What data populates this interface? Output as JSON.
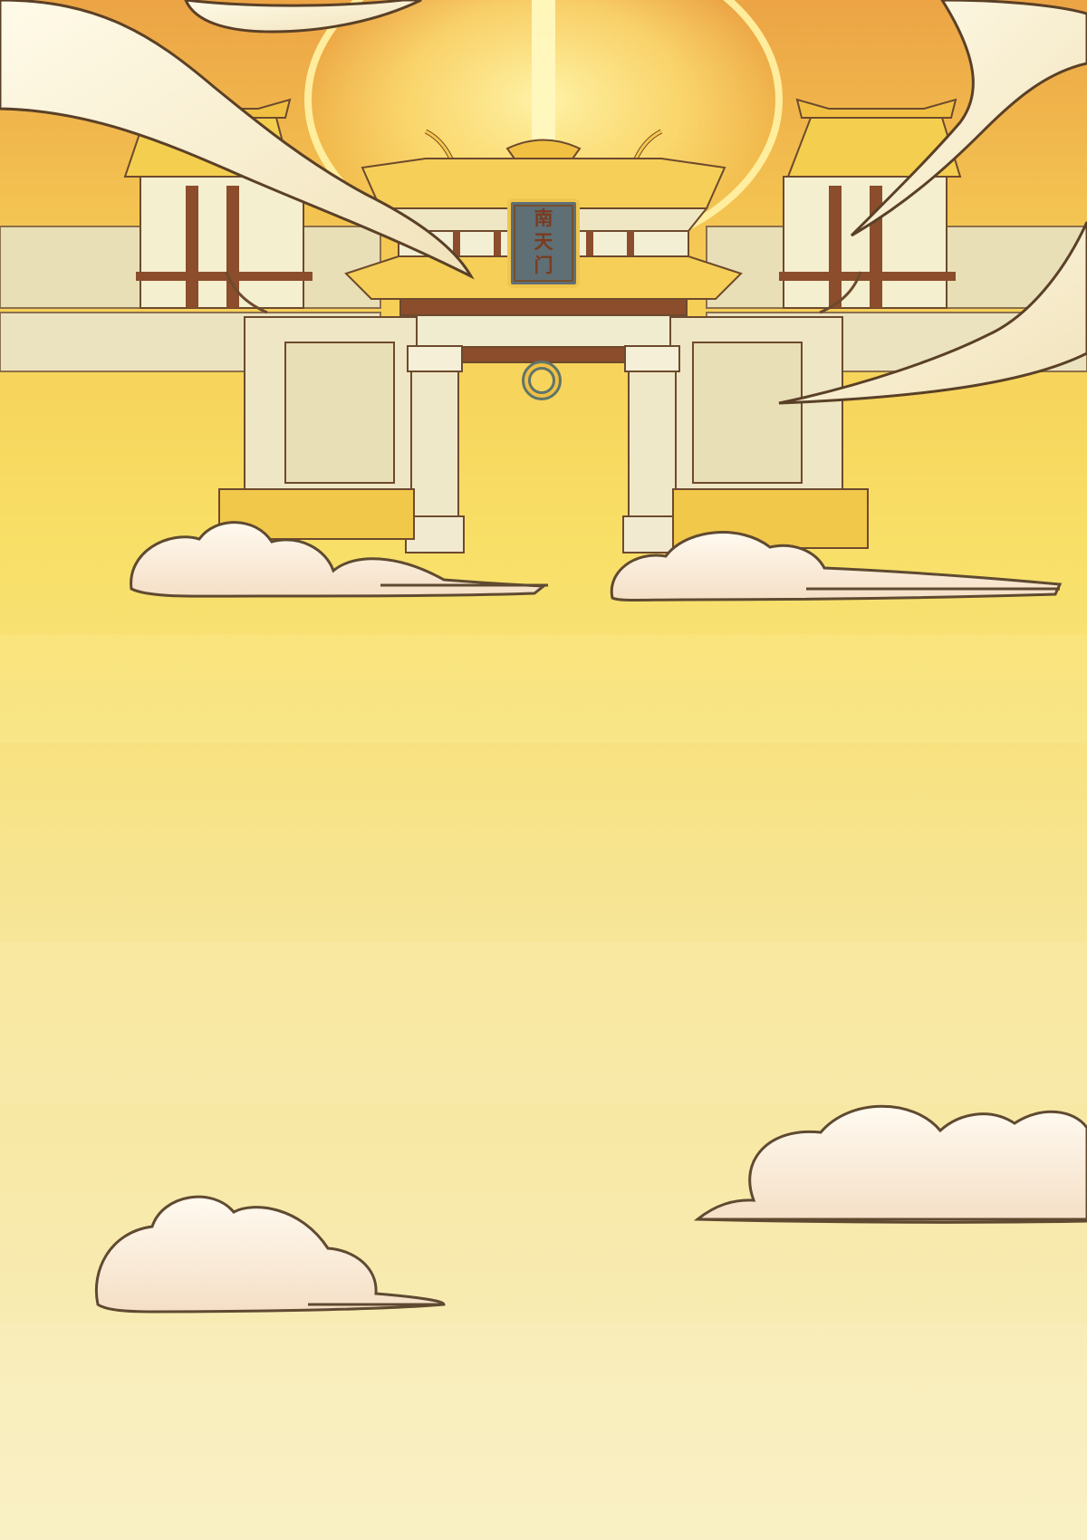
{
  "scene": {
    "name": "heavenly-gate-background",
    "gate_plaque": {
      "chars": [
        "南",
        "天",
        "门"
      ]
    },
    "colors": {
      "sky_top": "#f0b24d",
      "sky_mid": "#f4d562",
      "sky_bottom": "#f7ebba",
      "halo": "#fff6a8",
      "wall": "#eadfb8",
      "wall_shadow": "#d6c58c",
      "roof_gold": "#f2c242",
      "roof_dark": "#8b4d2b",
      "plaque": "#5e6f76",
      "cloud_fill": "#f9ecd2",
      "cloud_outline": "#6f5333"
    }
  }
}
